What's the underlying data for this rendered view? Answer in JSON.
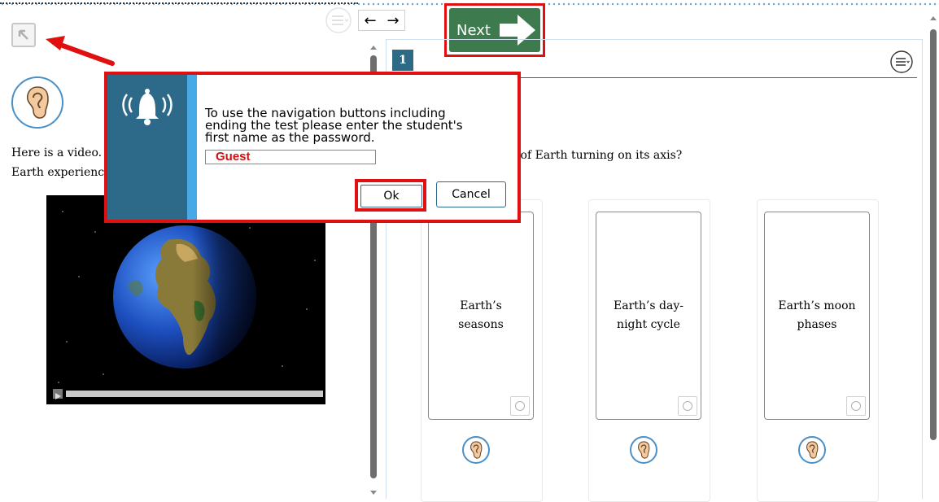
{
  "passage": {
    "intro_text_line1": "Here is a video. T",
    "intro_text_line2": "Earth experience"
  },
  "toolbar": {
    "back_arrow": "←",
    "forward_arrow": "→",
    "next_label": "Next"
  },
  "question": {
    "number": "1",
    "text": "lt of Earth turning on its axis?",
    "choices": [
      {
        "label": "Earth’s seasons"
      },
      {
        "label": "Earth’s day-night cycle"
      },
      {
        "label": "Earth’s moon phases"
      }
    ]
  },
  "dialog": {
    "message_line1": "To use the navigation buttons including",
    "message_line2": "ending the test please enter the student's",
    "message_line3": "first name as the password.",
    "password_value": "Guest",
    "ok_label": "Ok",
    "cancel_label": "Cancel"
  },
  "icons": {
    "ear": "ear-icon",
    "bell": "bell-icon",
    "menu": "menu-icon",
    "collapse": "collapse-icon"
  },
  "colors": {
    "accent_red": "#e01010",
    "dialog_blue": "#2d6a8a",
    "next_green": "#3d7a4e"
  }
}
